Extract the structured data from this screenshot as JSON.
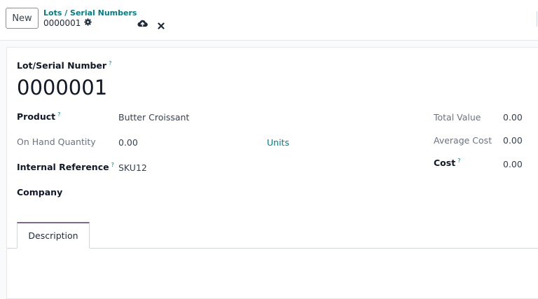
{
  "topbar": {
    "new_label": "New",
    "breadcrumb_parent": "Lots / Serial Numbers",
    "breadcrumb_current": "0000001"
  },
  "form": {
    "lot_label": "Lot/Serial Number",
    "lot_value": "0000001",
    "product_label": "Product",
    "product_value": "Butter Croissant",
    "on_hand_label": "On Hand Quantity",
    "on_hand_value": "0.00",
    "units_label": "Units",
    "internal_ref_label": "Internal Reference",
    "internal_ref_value": "SKU12",
    "company_label": "Company",
    "total_value_label": "Total Value",
    "total_value_value": "0.00",
    "avg_cost_label": "Average Cost",
    "avg_cost_value": "0.00",
    "cost_label": "Cost",
    "cost_value": "0.00",
    "help_mark": "?"
  },
  "tabs": [
    {
      "label": "Description"
    }
  ],
  "icons": {
    "gear": "gear-icon",
    "save": "cloud-upload-icon",
    "discard": "close-icon"
  },
  "colors": {
    "accent": "#017e84",
    "tab_active": "#7a6b8f"
  }
}
